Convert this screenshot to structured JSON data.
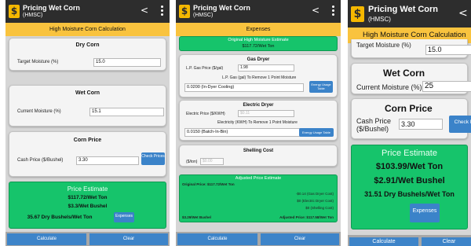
{
  "colors": {
    "app_bar": "#2d2d2d",
    "section_bar": "#f9c33e",
    "estimate_green": "#16c46b",
    "button_blue": "#3b83c9"
  },
  "icons": {
    "logo": "dollar-icon",
    "share": "share-icon",
    "overflow": "more-vert-icon"
  },
  "screen1": {
    "app_title": "Pricing Wet Corn",
    "app_subtitle": "(HMSC)",
    "section_title": "High Moisture Corn Calculation",
    "dry_corn": {
      "title": "Dry Corn",
      "label": "Target Moisture (%)",
      "value": "15.0"
    },
    "wet_corn": {
      "title": "Wet Corn",
      "label": "Current Moisture (%)",
      "value": "15.1"
    },
    "corn_price": {
      "title": "Corn Price",
      "label": "Cash Price ($/Bushel)",
      "value": "3.30",
      "button": "Check Prices"
    },
    "estimate": {
      "title": "Price Estimate",
      "per_ton": "$117.72/Wet Ton",
      "per_bushel": "$3.3/Wet Bushel",
      "dry_bushels": "35.67 Dry Bushels/Wet Ton",
      "expenses_button": "Expenses"
    },
    "calculate": "Calculate",
    "clear": "Clear"
  },
  "screen2": {
    "app_title": "Pricing Wet Corn",
    "app_subtitle": "(HMSC)",
    "section_title": "Expenses",
    "original": {
      "title": "Original High Moisture Estimate",
      "value": "$117.72/Wet Ton"
    },
    "gas_dryer": {
      "title": "Gas Dryer",
      "price_label": "L.P. Gas Price ($/gal)",
      "price_value": "1.98",
      "remove_label": "L.P. Gas (gal) To Remove 1 Point Moisture",
      "select_value": "0.0200 (In-Dyer Cooling)",
      "button": "Energy Usage Table"
    },
    "electric_dryer": {
      "title": "Electric Dryer",
      "price_label": "Electric Price ($/KWH)",
      "price_value": "$0.11",
      "remove_label": "Electricity (KWH) To Remove 1 Point Moisture",
      "select_value": "0.0150 (Batch-In-Bin)",
      "button": "Energy Usage Table"
    },
    "shelling": {
      "title": "Shelling Cost",
      "label": "($/ton)",
      "value": "$0.00"
    },
    "adjusted": {
      "title": "Adjusted Price Estimate",
      "original_line": "Original Price: $117.72/Wet Ton",
      "line1": "-$0.14 (Gas Dryer Cost)",
      "line2": "$0 (Electric Dryer Cost)",
      "line3": "$0 (Shelling Cost)",
      "bushel": "$3.29/Wet Bushel",
      "adjusted_price": "Adjusted Price: $117.58/Wet Ton"
    },
    "calculate": "Calculate",
    "clear": "Clear"
  },
  "screen3": {
    "app_title": "Pricing Wet Corn",
    "app_subtitle": "(HMSC)",
    "section_title": "High Moisture Corn Calculation",
    "target_label": "Target Moisture (%)",
    "target_value": "15.0",
    "wet_corn": {
      "title": "Wet Corn",
      "label": "Current Moisture (%)",
      "value": "25"
    },
    "corn_price": {
      "title": "Corn Price",
      "label_line1": "Cash Price",
      "label_line2": "($/Bushel)",
      "value": "3.30",
      "button": "Check Pr"
    },
    "estimate": {
      "title": "Price Estimate",
      "per_ton": "$103.99/Wet Ton",
      "per_bushel": "$2.91/Wet Bushel",
      "dry_bushels": "31.51 Dry Bushels/Wet Ton",
      "expenses_button": "Expenses"
    },
    "calculate": "Calculate",
    "clear": "Clear"
  }
}
